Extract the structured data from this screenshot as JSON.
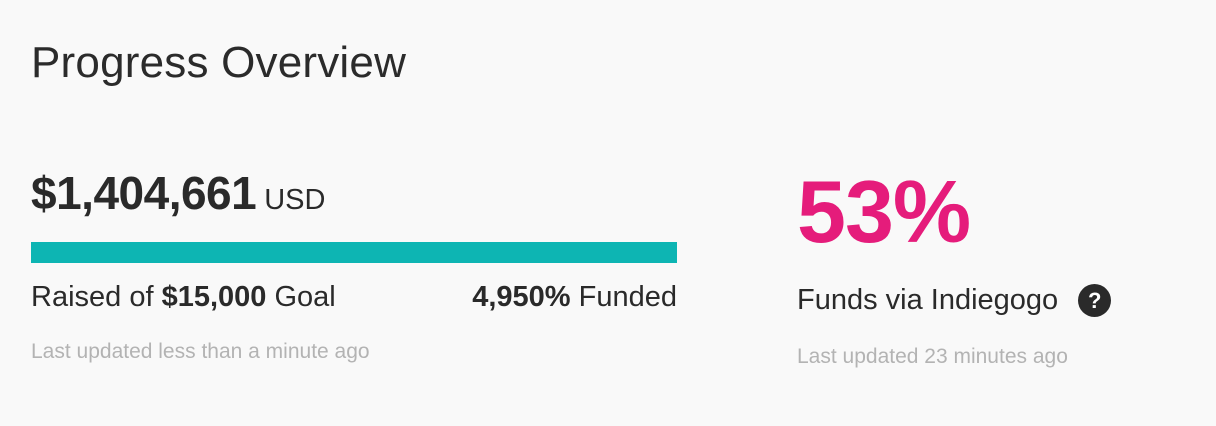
{
  "title": "Progress Overview",
  "campaign": {
    "amount": "$1,404,661",
    "currency": "USD",
    "progress_fraction": 1.0,
    "bar_color": "#0db5b3",
    "raised_prefix": "Raised of",
    "goal": "$15,000",
    "goal_suffix": "Goal",
    "funded_percent": "4,950%",
    "funded_label": "Funded",
    "updated": "Last updated less than a minute ago"
  },
  "indiegogo": {
    "percent": "53%",
    "percent_color": "#e51c7b",
    "label": "Funds via Indiegogo",
    "help_icon": "?",
    "updated": "Last updated 23 minutes ago"
  }
}
